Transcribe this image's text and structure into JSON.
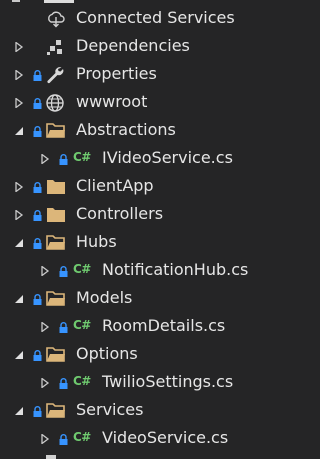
{
  "solution_explorer": {
    "items": [
      {
        "label": "Connected Services",
        "icon": "cloud-connected-icon",
        "expander": "none",
        "locked": false
      },
      {
        "label": "Dependencies",
        "icon": "dependencies-icon",
        "expander": "collapsed",
        "locked": false
      },
      {
        "label": "Properties",
        "icon": "wrench-icon",
        "expander": "collapsed",
        "locked": true
      },
      {
        "label": "wwwroot",
        "icon": "globe-icon",
        "expander": "collapsed",
        "locked": true
      },
      {
        "label": "Abstractions",
        "icon": "folder-open-icon",
        "expander": "expanded",
        "locked": true
      },
      {
        "label": "IVideoService.cs",
        "icon": "csharp-file-icon",
        "expander": "collapsed",
        "locked": true
      },
      {
        "label": "ClientApp",
        "icon": "folder-icon",
        "expander": "collapsed",
        "locked": true
      },
      {
        "label": "Controllers",
        "icon": "folder-icon",
        "expander": "collapsed",
        "locked": true
      },
      {
        "label": "Hubs",
        "icon": "folder-open-icon",
        "expander": "expanded",
        "locked": true
      },
      {
        "label": "NotificationHub.cs",
        "icon": "csharp-file-icon",
        "expander": "collapsed",
        "locked": true
      },
      {
        "label": "Models",
        "icon": "folder-open-icon",
        "expander": "expanded",
        "locked": true
      },
      {
        "label": "RoomDetails.cs",
        "icon": "csharp-file-icon",
        "expander": "collapsed",
        "locked": true
      },
      {
        "label": "Options",
        "icon": "folder-open-icon",
        "expander": "expanded",
        "locked": true
      },
      {
        "label": "TwilioSettings.cs",
        "icon": "csharp-file-icon",
        "expander": "collapsed",
        "locked": true
      },
      {
        "label": "Services",
        "icon": "folder-open-icon",
        "expander": "expanded",
        "locked": true
      },
      {
        "label": "VideoService.cs",
        "icon": "csharp-file-icon",
        "expander": "collapsed",
        "locked": true
      }
    ],
    "csharp_badge": "C#"
  },
  "colors": {
    "background": "#252526",
    "text": "#e6e6e6",
    "folder": "#dcb67a",
    "csharp": "#6fca6f",
    "lock": "#3794ff",
    "expander": "#c8c8c8"
  }
}
